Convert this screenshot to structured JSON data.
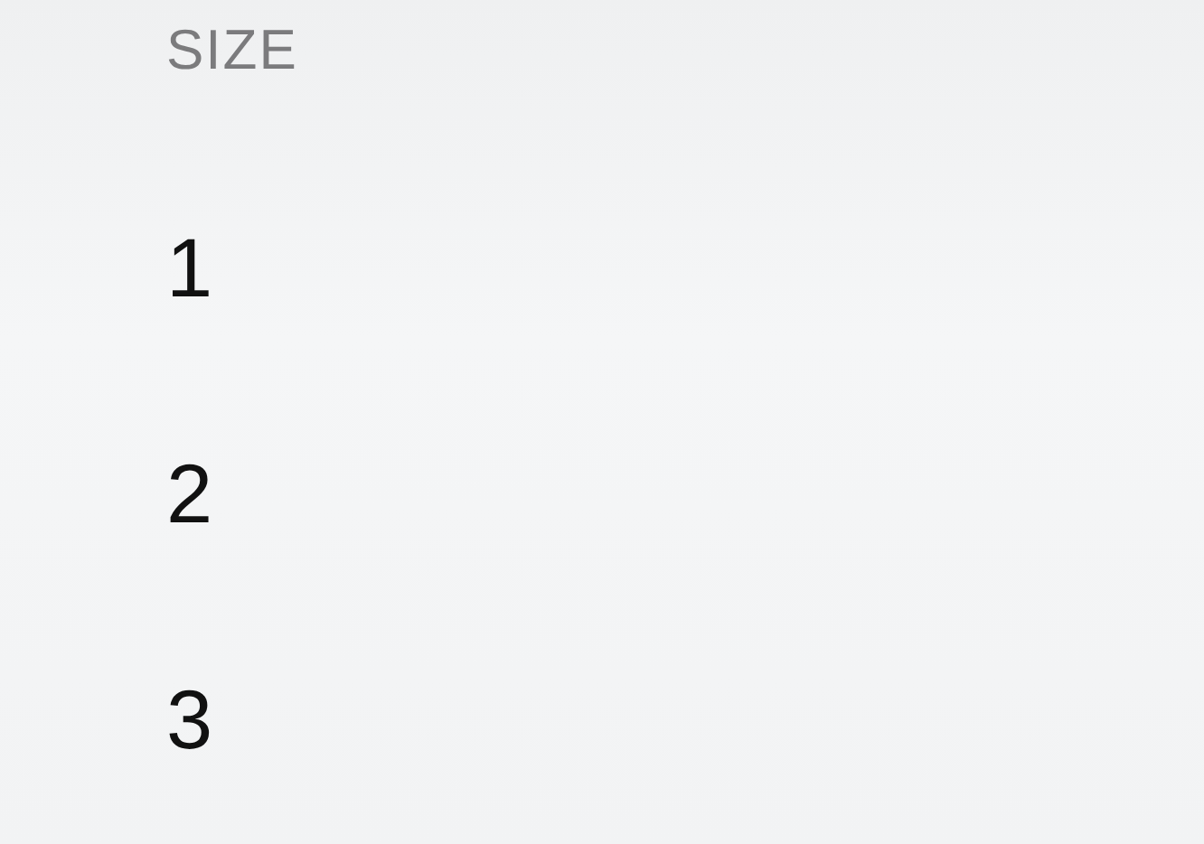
{
  "header": "SIZE",
  "options": [
    {
      "label": "1"
    },
    {
      "label": "2"
    },
    {
      "label": "3"
    }
  ]
}
